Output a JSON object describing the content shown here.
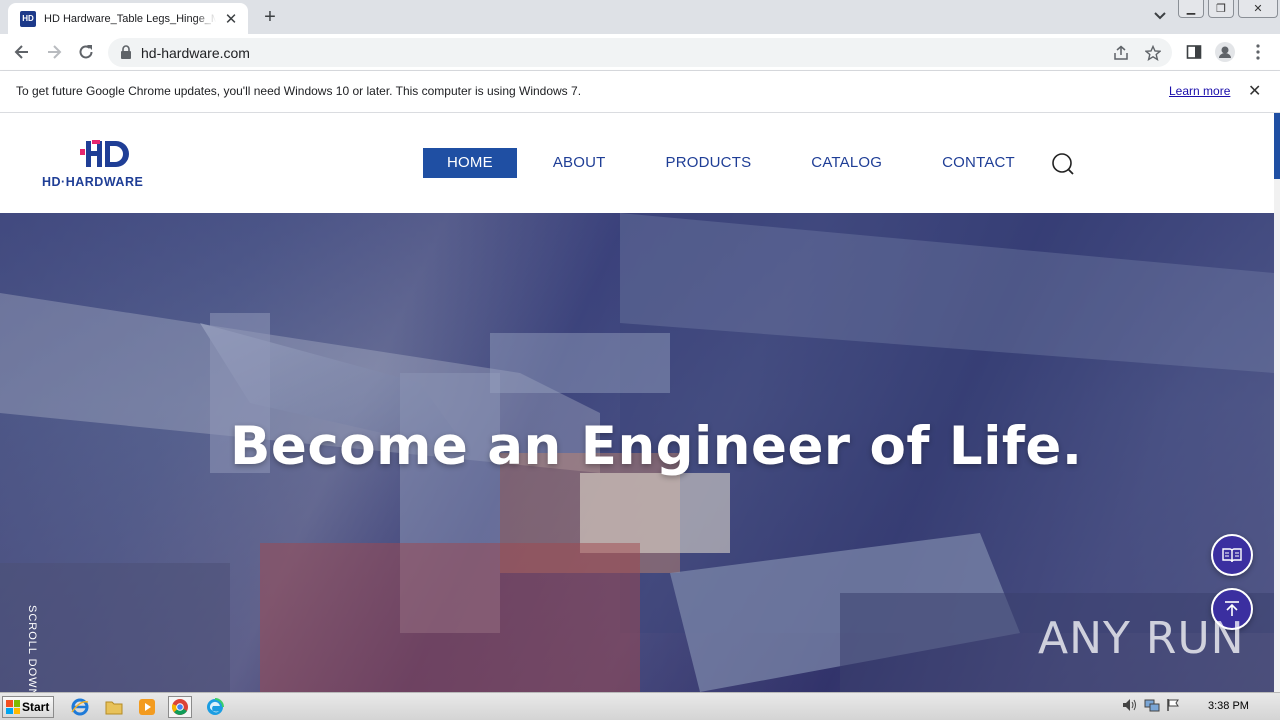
{
  "browser": {
    "tab_title": "HD Hardware_Table Legs_Hinge_Metal",
    "tab_favicon_text": "HD",
    "url": "hd-hardware.com",
    "icons": {
      "back": "arrow-left-icon",
      "forward": "arrow-right-icon",
      "reload": "reload-icon",
      "lock": "lock-icon",
      "share": "share-icon",
      "bookmark": "star-icon",
      "sidepanel": "side-panel-icon",
      "profile": "profile-icon",
      "menu": "kebab-menu-icon"
    }
  },
  "infobar": {
    "message": "To get future Google Chrome updates, you'll need Windows 10 or later. This computer is using Windows 7.",
    "link": "Learn more",
    "close": "✕"
  },
  "site": {
    "logo_mark": "HD",
    "logo_text": "HD·HARDWARE",
    "brand_color": "#1f3e96",
    "accent_color": "#e6266e",
    "nav": [
      {
        "label": "HOME",
        "active": true
      },
      {
        "label": "ABOUT",
        "active": false
      },
      {
        "label": "PRODUCTS",
        "active": false
      },
      {
        "label": "CATALOG",
        "active": false
      },
      {
        "label": "CONTACT",
        "active": false
      }
    ],
    "hero_title": "Become an Engineer of Life.",
    "scroll_label": "SCROLL DOWN",
    "watermark": "ANY RUN"
  },
  "taskbar": {
    "start_label": "Start",
    "clock": "3:38 PM"
  }
}
